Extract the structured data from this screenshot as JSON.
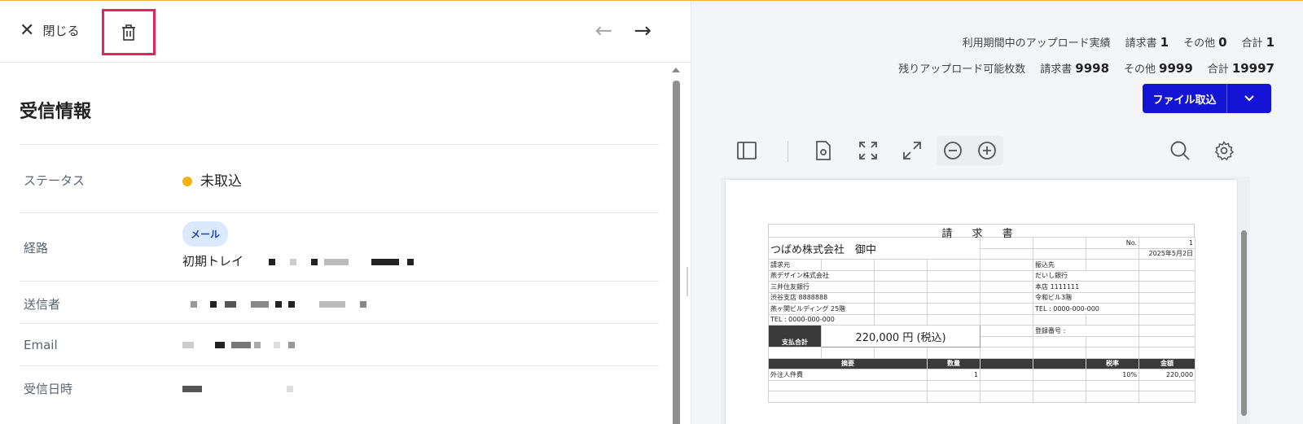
{
  "toolbar": {
    "close_label": "閉じる",
    "prev_arrow": "←",
    "next_arrow": "→"
  },
  "info": {
    "title": "受信情報",
    "rows": [
      {
        "label": "ステータス",
        "value": "未取込"
      },
      {
        "label": "経路",
        "chip": "メール",
        "value": "初期トレイ"
      },
      {
        "label": "送信者"
      },
      {
        "label": "Email"
      },
      {
        "label": "受信日時"
      }
    ]
  },
  "usage": {
    "period_label": "利用期間中のアップロード実績",
    "period_invoice_label": "請求書",
    "period_invoice": "1",
    "period_other_label": "その他",
    "period_other": "0",
    "period_total_label": "合計",
    "period_total": "1",
    "remain_label": "残りアップロード可能枚数",
    "remain_invoice_label": "請求書",
    "remain_invoice": "9998",
    "remain_other_label": "その他",
    "remain_other": "9999",
    "remain_total_label": "合計",
    "remain_total": "19997"
  },
  "import_button": {
    "label": "ファイル取込"
  },
  "viewer": {
    "icons": [
      "sidebar-icon",
      "page-settings-icon",
      "fit-page-icon",
      "fit-width-icon",
      "zoom-out-icon",
      "zoom-in-icon",
      "search-icon",
      "gear-icon"
    ]
  },
  "invoice": {
    "title": "請 求 書",
    "addressee": "つばめ株式会社",
    "honorific": "御中",
    "no_label": "No.",
    "no_value": "1",
    "date": "2025年5月2日",
    "sender_label": "請求元",
    "sender_lines": [
      "燕デザイン株式会社",
      "三井住友銀行",
      "渋谷支店 8888888",
      "燕ヶ関ビルディング 25階",
      "TEL : 0000-000-000"
    ],
    "payee_label": "振込先",
    "payee_lines": [
      "だいし銀行",
      "本店 1111111",
      "令和ビル3階",
      "TEL : 0000-000-000"
    ],
    "total_label": "支払合計",
    "total_value": "220,000 円 (税込)",
    "reg_label": "登録番号 :",
    "headers": {
      "item": "摘要",
      "qty": "数量",
      "tax": "税率",
      "amount": "金額"
    },
    "items": [
      {
        "item": "外注人件費",
        "qty": "1",
        "tax": "10%",
        "amount": "220,000"
      }
    ]
  }
}
